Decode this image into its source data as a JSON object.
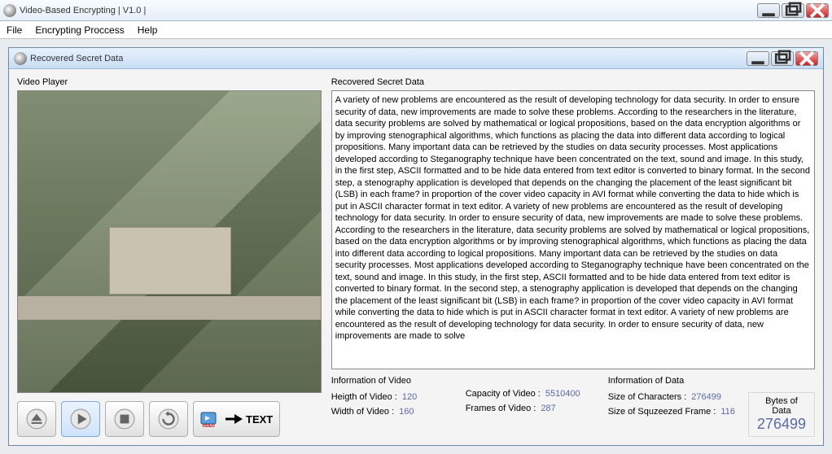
{
  "outer_window": {
    "title": "Video-Based Encrypting | V1.0 |"
  },
  "menu": {
    "file": "File",
    "encrypt": "Encrypting Proccess",
    "help": "Help"
  },
  "inner_window": {
    "title": "Recovered Secret Data"
  },
  "video_player_label": "Video Player",
  "recovered_label": "Recovered Secret Data",
  "recovered_text": "A variety of new problems are encountered as the result of developing technology for data security. In order to ensure security of data, new improvements are made to solve these problems. According to the researchers in the literature, data security problems are solved by mathematical or logical propositions, based on the data encryption algorithms or by improving stenographical algorithms, which functions as placing the data into different data according to logical propositions. Many important data can be retrieved by the studies on data security processes. Most applications developed according to Steganography technique have been concentrated on the text, sound and image. In this study, in the first step, ASCII formatted and to be hide data entered from text editor is converted to binary format. In the second step, a stenography application is developed that depends on the changing the placement of the least significant bit (LSB) in each frame? in proportion of the cover video capacity in AVI format while converting the data to hide which is put in ASCII character format in text editor. A variety of new problems are encountered as the result of developing technology for data security. In order to ensure security of data, new improvements are made to solve these problems. According to the researchers in the literature, data security problems are solved by mathematical or logical propositions, based on the data encryption algorithms or by improving stenographical algorithms, which functions as placing the data into different data according to logical propositions. Many important data can be retrieved by the studies on data security processes. Most applications developed according to Steganography technique have been concentrated on the text, sound and image. In this study, in the first step, ASCII formatted and to be hide data entered from text editor is converted to binary format. In the second step, a stenography application is developed that depends on the changing the placement of the least significant bit (LSB) in each frame? in proportion of the cover video capacity in AVI format while converting the data to hide which is put in ASCII character format in text editor. A variety of new problems are encountered as the result of developing technology for data security. In order to ensure security of data, new improvements are made to solve",
  "text_btn_label": "TEXT",
  "info_video": {
    "title": "Information of Video",
    "height_label": "Heigth of Video :",
    "height_value": "120",
    "width_label": "Width of Video :",
    "width_value": "160",
    "capacity_label": "Capacity of Video :",
    "capacity_value": "5510400",
    "frames_label": "Frames of Video :",
    "frames_value": "287"
  },
  "info_data": {
    "title": "Information of Data",
    "size_chars_label": "Size of Characters :",
    "size_chars_value": "276499",
    "squeezed_label": "Size of Squzeezed Frame :",
    "squeezed_value": "116",
    "bytes_label": "Bytes of Data",
    "bytes_value": "276499"
  }
}
